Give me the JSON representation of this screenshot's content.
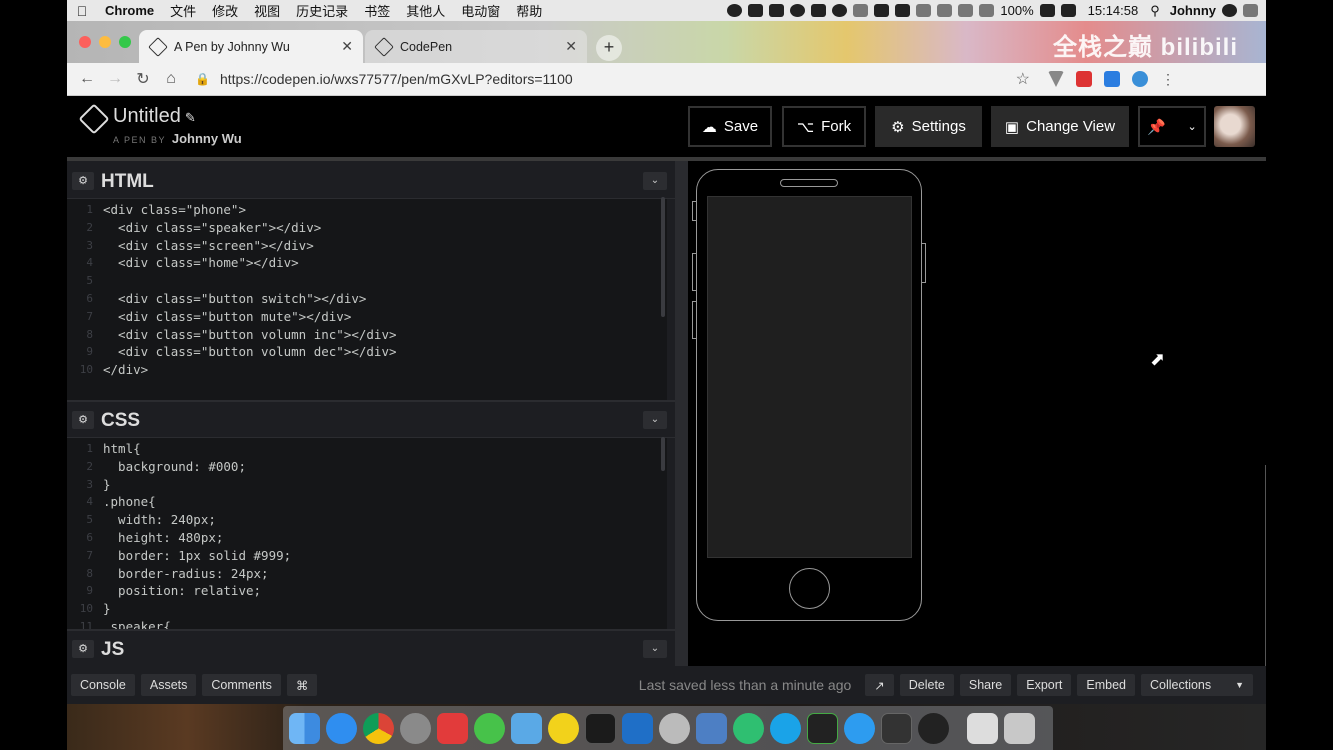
{
  "menubar": {
    "app": "Chrome",
    "items": [
      "文件",
      "修改",
      "视图",
      "历史记录",
      "书签",
      "其他人",
      "电动窗",
      "帮助"
    ],
    "battery": "100%",
    "time": "15:14:58",
    "user": "Johnny"
  },
  "browser": {
    "tabs": [
      {
        "title": "A Pen by Johnny Wu",
        "active": true
      },
      {
        "title": "CodePen",
        "active": false
      }
    ],
    "url": "https://codepen.io/wxs77577/pen/mGXvLP?editors=1100",
    "watermark": "全栈之巅 bilibili"
  },
  "codepen": {
    "title": "Untitled",
    "by_label": "A PEN BY",
    "author": "Johnny Wu",
    "buttons": {
      "save": "Save",
      "fork": "Fork",
      "settings": "Settings",
      "change_view": "Change View"
    }
  },
  "editors": {
    "html": {
      "title": "HTML",
      "lines": [
        {
          "n": "1",
          "code": "<div class=\"phone\">"
        },
        {
          "n": "2",
          "code": "  <div class=\"speaker\"></div>"
        },
        {
          "n": "3",
          "code": "  <div class=\"screen\"></div>"
        },
        {
          "n": "4",
          "code": "  <div class=\"home\"></div>"
        },
        {
          "n": "5",
          "code": ""
        },
        {
          "n": "6",
          "code": "  <div class=\"button switch\"></div>"
        },
        {
          "n": "7",
          "code": "  <div class=\"button mute\"></div>"
        },
        {
          "n": "8",
          "code": "  <div class=\"button volumn inc\"></div>"
        },
        {
          "n": "9",
          "code": "  <div class=\"button volumn dec\"></div>"
        },
        {
          "n": "10",
          "code": "</div>"
        }
      ]
    },
    "css": {
      "title": "CSS",
      "lines": [
        {
          "n": "1",
          "code": "html{"
        },
        {
          "n": "2",
          "code": "  background: #000;"
        },
        {
          "n": "3",
          "code": "}"
        },
        {
          "n": "4",
          "code": ".phone{"
        },
        {
          "n": "5",
          "code": "  width: 240px;"
        },
        {
          "n": "6",
          "code": "  height: 480px;"
        },
        {
          "n": "7",
          "code": "  border: 1px solid #999;"
        },
        {
          "n": "8",
          "code": "  border-radius: 24px;"
        },
        {
          "n": "9",
          "code": "  position: relative;"
        },
        {
          "n": "10",
          "code": "}"
        },
        {
          "n": "11",
          "code": ".speaker{"
        }
      ]
    },
    "js": {
      "title": "JS"
    }
  },
  "footer": {
    "left": [
      "Console",
      "Assets",
      "Comments",
      "⌘"
    ],
    "status": "Last saved less than a minute ago",
    "right": [
      "Delete",
      "Share",
      "Export",
      "Embed"
    ],
    "collections": "Collections"
  },
  "colors": {
    "code_tag": "#c5c8c6",
    "code_attr": "#88c0d0",
    "code_value": "#a6e22e",
    "code_number": "#f07178",
    "code_selector": "#81a2be"
  }
}
